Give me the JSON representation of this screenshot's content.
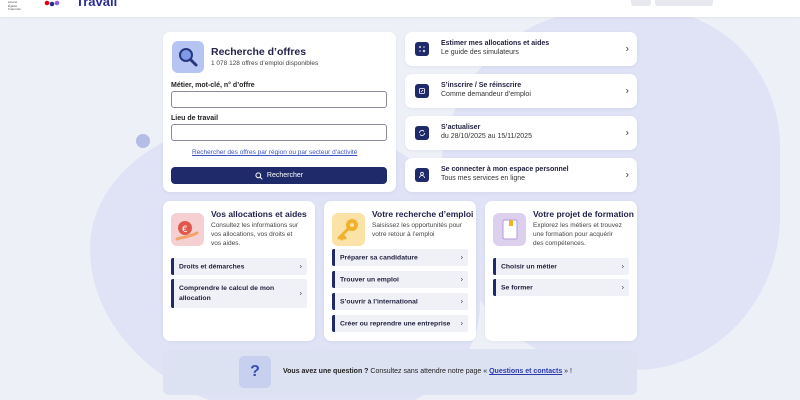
{
  "header": {
    "logo_small": "Liberté Égalité Fraternité",
    "logo_text": "Travail"
  },
  "search": {
    "title": "Recherche d’offres",
    "subtitle": "1 078 128 offres d’emploi disponibles",
    "keyword_label": "Métier, mot-clé, n° d’offre",
    "keyword_value": "",
    "location_label": "Lieu de travail",
    "location_value": "",
    "region_link": "Rechercher des offres par région ou par secteur d’activité",
    "submit_label": "Rechercher"
  },
  "quick_links": [
    {
      "title": "Estimer mes allocations et aides",
      "subtitle": "Le guide des simulateurs"
    },
    {
      "title": "S’inscrire / Se réinscrire",
      "subtitle": "Comme demandeur d’emploi"
    },
    {
      "title": "S’actualiser",
      "subtitle": "du 28/10/2025 au 15/11/2025"
    },
    {
      "title": "Se connecter à mon espace personnel",
      "subtitle": "Tous mes services en ligne"
    }
  ],
  "cards": {
    "allocations": {
      "title": "Vos allocations et aides",
      "desc1": "Consultez les informations sur",
      "desc2": "vos allocations, vos droits et",
      "desc3": "vos aides.",
      "items": [
        "Droits et démarches",
        "Comprendre le calcul de mon",
        "allocation"
      ]
    },
    "emploi": {
      "title": "Votre recherche d’emploi",
      "desc1": "Saisissez les opportunités pour",
      "desc2": "votre retour à l’emploi",
      "items": [
        "Préparer sa candidature",
        "Trouver un emploi",
        "S’ouvrir à l’international",
        "Créer ou reprendre une entreprise"
      ]
    },
    "formation": {
      "title": "Votre projet de formation",
      "desc1": "Explorez les métiers et trouvez",
      "desc2": "une formation pour acquérir",
      "desc3": "des compétences.",
      "items": [
        "Choisir un métier",
        "Se former"
      ]
    }
  },
  "faq": {
    "question": "Vous avez une question ?",
    "text": " Consultez sans attendre notre page « ",
    "link": "Questions et contacts",
    "end": " » !"
  },
  "colors": {
    "primary": "#1f2a6b",
    "background": "#eef0f8",
    "link": "#3b52c4"
  }
}
